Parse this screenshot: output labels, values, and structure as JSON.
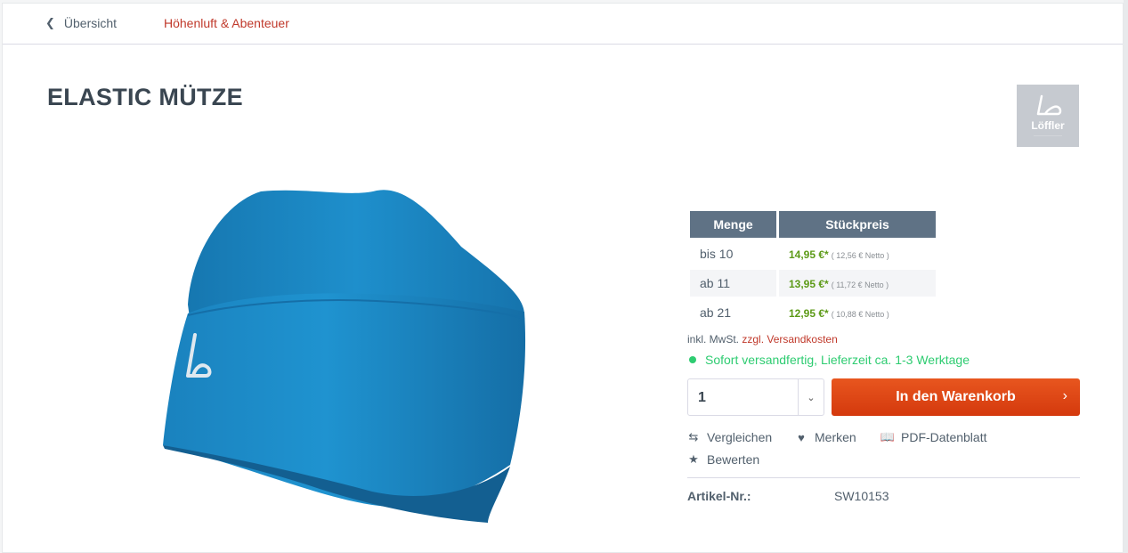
{
  "breadcrumb": {
    "back_label": "Übersicht",
    "category": "Höhenluft & Abenteuer"
  },
  "product": {
    "title": "ELASTIC MÜTZE",
    "brand": "Löffler",
    "image_alt": "Elastic Mütze blau",
    "color": "#1a8ac8"
  },
  "price_table": {
    "headers": [
      "Menge",
      "Stückpreis"
    ],
    "rows": [
      {
        "qty": "bis 10",
        "price": "14,95 €*",
        "net": "( 12,56 € Netto )"
      },
      {
        "qty": "ab 11",
        "price": "13,95 €*",
        "net": "( 11,72 € Netto )"
      },
      {
        "qty": "ab 21",
        "price": "12,95 €*",
        "net": "( 10,88 € Netto )"
      }
    ]
  },
  "tax": {
    "prefix": "inkl. MwSt.",
    "link": "zzgl. Versandkosten"
  },
  "delivery": {
    "text": "Sofort versandfertig, Lieferzeit ca. 1-3 Werktage"
  },
  "buy": {
    "quantity": "1",
    "cart_label": "In den Warenkorb"
  },
  "actions": {
    "compare": "Vergleichen",
    "remember": "Merken",
    "pdf": "PDF-Datenblatt",
    "rate": "Bewerten"
  },
  "article": {
    "label": "Artikel-Nr.:",
    "number": "SW10153"
  },
  "colors": {
    "accent": "#d4390d",
    "link": "#c0392b",
    "price": "#5c9a17",
    "instock": "#2ecc71"
  }
}
